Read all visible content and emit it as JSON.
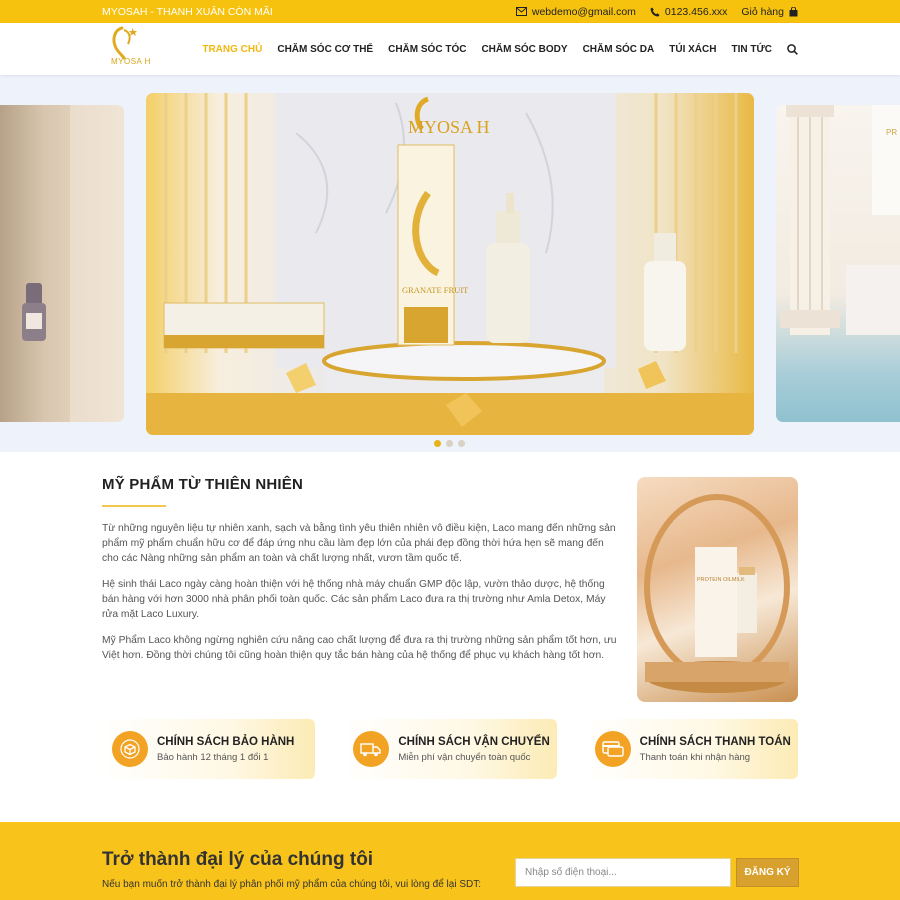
{
  "topbar": {
    "tagline": "MYOSAH - THANH XUÂN CÒN MÃI",
    "email": "webdemo@gmail.com",
    "phone": "0123.456.xxx",
    "cart": "Giỏ hàng"
  },
  "header": {
    "logo_text": "MYOSA H",
    "nav": [
      "TRANG CHỦ",
      "CHĂM SÓC CƠ THỂ",
      "CHĂM SÓC TÓC",
      "CHĂM SÓC BODY",
      "CHĂM SÓC DA",
      "TÚI XÁCH",
      "TIN TỨC"
    ],
    "active_nav_index": 0
  },
  "slider": {
    "center_slide_text": "MYOSA H",
    "product_label": "GRANATE FRUIT",
    "left_partial": "",
    "right_partial": "PR",
    "active_dot": 0,
    "dot_count": 3
  },
  "about": {
    "title": "MỸ PHẨM TỪ THIÊN NHIÊN",
    "paragraphs": [
      "Từ những nguyên liệu tự nhiên xanh, sạch và bằng tình yêu thiên nhiên vô điều kiện, Laco mang đến những sản phẩm mỹ phẩm chuẩn hữu cơ để đáp ứng nhu cầu làm đẹp lớn của phái đẹp đồng thời hứa hẹn sẽ mang đến cho các Nàng những sản phẩm an toàn và chất lượng nhất, vươn tầm quốc tế.",
      "Hệ sinh thái Laco ngày càng hoàn thiện với hệ thống nhà máy chuẩn GMP độc lập, vườn thảo dược, hệ thống bán hàng với hơn 3000 nhà phân phối toàn quốc. Các sản phẩm Laco đưa ra thị trường như Amla Detox, Máy rửa mặt Laco Luxury.",
      "Mỹ Phẩm Laco không ngừng nghiên cứu nâng cao chất lượng để đưa ra thị trường những sản phẩm tốt hơn, ưu Việt hơn. Đồng thời chúng tôi cũng hoàn thiện quy tắc bán hàng của hệ thống để phục vụ khách hàng tốt hơn."
    ],
    "image_label": "PROTEIN OILMILK"
  },
  "policies": [
    {
      "icon": "box-icon",
      "title": "CHÍNH SÁCH BẢO HÀNH",
      "sub": "Bảo hành 12 tháng 1 đổi 1"
    },
    {
      "icon": "truck-icon",
      "title": "CHÍNH SÁCH VẬN CHUYỂN",
      "sub": "Miễn phí vận chuyển toàn quốc"
    },
    {
      "icon": "card-icon",
      "title": "CHÍNH SÁCH THANH TOÁN",
      "sub": "Thanh toán khi nhận hàng"
    }
  ],
  "agent": {
    "title": "Trở thành đại lý của chúng tôi",
    "sub": "Nếu bạn muốn trở thành đại lý phân phối mỹ phẩm của chúng tôi, vui lòng để lại SDT:",
    "phone_placeholder": "Nhập số điện thoại...",
    "phone_value": "",
    "submit": "ĐĂNG KÝ"
  },
  "colors": {
    "brand_yellow": "#f6c20e",
    "accent_gold": "#d8a12e",
    "active_nav": "#f2b810",
    "policy_icon": "#f3a324"
  }
}
